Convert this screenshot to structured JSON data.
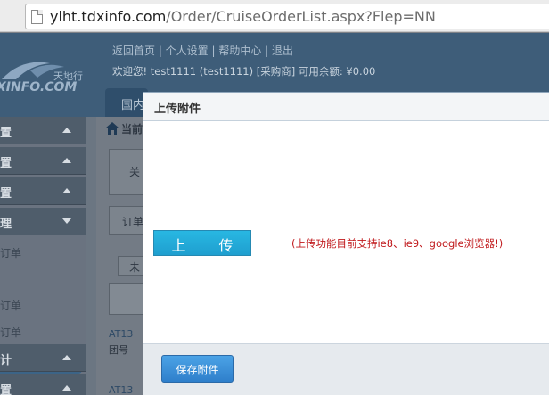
{
  "browser": {
    "url_host": "ylht.tdxinfo.com",
    "url_path": "/Order/CruiseOrderList.aspx?Flep=NN"
  },
  "site": {
    "logo_cn": "天地行",
    "logo_en": "XINFO.COM",
    "top_links": "返回首页 | 个人设置 | 帮助中心 | 退出",
    "welcome": "欢迎您! test1111 (test1111) [采购商] 可用余额: ¥0.00",
    "nav_tab": "国内",
    "menu": [
      {
        "label": "置",
        "state": "up"
      },
      {
        "label": "置",
        "state": "up"
      },
      {
        "label": "置",
        "state": "up"
      },
      {
        "label": "理",
        "state": "down"
      }
    ],
    "menu_subitems": [
      "订单",
      "管理",
      "订单",
      "订单"
    ],
    "menu_footer": [
      {
        "label": "计",
        "state": "up"
      },
      {
        "label": "置",
        "state": "up"
      }
    ],
    "breadcrumb": "当前",
    "content_box1": "关",
    "content_box2": "订单",
    "content_tab": "未",
    "content_rows": [
      "AT13",
      "团号",
      "AT13"
    ]
  },
  "modal": {
    "title": "上传附件",
    "upload_button": "上 传",
    "upload_note": "(上传功能目前支持ie8、ie9、google浏览器!)",
    "save_button": "保存附件"
  },
  "colors": {
    "upload_button": "#1fa7d6",
    "save_button": "#3b8fd8",
    "note_text": "#c0181b"
  }
}
